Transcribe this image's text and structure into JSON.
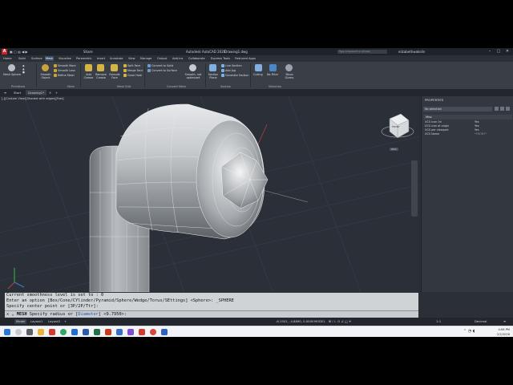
{
  "app": {
    "logo": "A",
    "title": "Autodesk AutoCAD 2026",
    "document": "Drawing1.dwg",
    "quick_share": "Share",
    "search_placeholder": "Type a keyword or phrase",
    "user": "elizabethwakelin"
  },
  "ribbon_tabs": [
    "Home",
    "Solid",
    "Surface",
    "Mesh",
    "Visualize",
    "Parametric",
    "Insert",
    "Annotate",
    "View",
    "Manage",
    "Output",
    "Add-ins",
    "Collaborate",
    "Express Tools",
    "Featured Apps"
  ],
  "active_tab": "Mesh",
  "ribbon": {
    "mesh_sphere": "Mesh Sphere",
    "smooth_object": "Smooth Object",
    "smooth_more": "Smooth More",
    "smooth_less": "Smooth Less",
    "refine_mesh": "Refine Mesh",
    "add_crease": "Add Crease",
    "remove_crease": "Remove Crease",
    "extrude_face": "Extrude Face",
    "split_face": "Split Face",
    "merge_face": "Merge Face",
    "close_hole": "Close Hole",
    "convert_to_solid": "Convert to Solid",
    "convert_to_surface": "Convert to Surface",
    "smooth_not_optimized": "Smooth, not optimized",
    "section_plane": "Section Plane",
    "live_section": "Live Section",
    "add_jog": "Add Jog",
    "generate_section": "Generate Section",
    "culling": "Culling",
    "no_filter": "No Filter",
    "move_gizmo": "Move Gizmo",
    "panels": [
      "Primitives",
      "Mesh",
      "Mesh Edit",
      "Convert Mesh",
      "Section",
      "Selection"
    ]
  },
  "file_tabs": [
    "Start",
    "Drawing1*"
  ],
  "viewport_label": "[-][Custom View][Shaded with edges][Fast]",
  "viewcube_label": "FRONT",
  "wcs_label": "WCS",
  "properties": {
    "title": "PROPERTIES",
    "selection": "No selection",
    "section": "Misc",
    "rows": [
      {
        "label": "UCS icon On",
        "value": "Yes"
      },
      {
        "label": "UCS icon at origin",
        "value": "Yes"
      },
      {
        "label": "UCS per viewport",
        "value": "Yes"
      },
      {
        "label": "UCS Name",
        "value": "*FRONT*"
      }
    ]
  },
  "command": {
    "history": [
      "Current smoothness level is set to : 0",
      "Enter an option [Box/Cone/CYlinder/Pyramid/Sphere/Wedge/Torus/SEttings] <Sphere>: _SPHERE",
      "Specify center point or [3P/2P/Ttr]:"
    ],
    "prompt_cmd": "MESH",
    "prompt_text": "Specify radius or",
    "option": "Diameter",
    "default": "<9.7950>:"
  },
  "status": {
    "tabs": [
      "Model",
      "Layout1",
      "Layout2"
    ],
    "coords": "-6.1501, -4.8890, 0.0000",
    "mode": "MODEL",
    "scale": "1:1",
    "units": "Decimal"
  },
  "taskbar": {
    "time": "4:06 PM",
    "date": "2/2/2026"
  }
}
